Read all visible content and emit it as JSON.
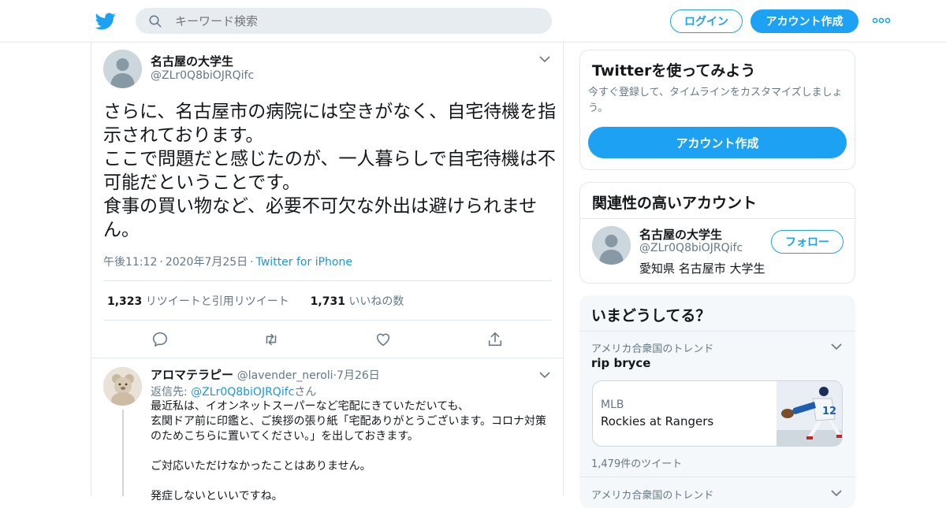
{
  "header": {
    "search_placeholder": "キーワード検索",
    "login_label": "ログイン",
    "signup_label": "アカウント作成"
  },
  "tweet": {
    "display_name": "名古屋の大学生",
    "handle": "@ZLr0Q8biOJRQifc",
    "lines": [
      "さらに、名古屋市の病院には空きがなく、自宅待機を指示されております。",
      "ここで問題だと感じたのが、一人暮らしで自宅待機は不可能だということです。",
      "食事の買い物など、必要不可欠な外出は避けられません。"
    ],
    "time": "午後11:12",
    "date": "2020年7月25日",
    "source": "Twitter for iPhone",
    "retweet_count": "1,323",
    "retweet_label": "リツイートと引用リツイート",
    "like_count": "1,731",
    "like_label": "いいねの数"
  },
  "reply": {
    "display_name": "アロマテラピー",
    "handle": "@lavender_neroli",
    "date": "7月26日",
    "reply_to_prefix": "返信先: ",
    "reply_to_handle": "@ZLr0Q8biOJRQifc",
    "reply_to_suffix": "さん",
    "paragraphs": [
      "最近私は、イオンネットスーパーなど宅配にきていただいても、\n玄関ドア前に印鑑と、ご挨拶の張り紙「宅配ありがとうございます。コロナ対策のためこちらに置いてください。」を出しておきます。",
      "ご対応いただけなかったことはありません。",
      "発症しないといいですね。"
    ]
  },
  "sidebar": {
    "signup_card": {
      "title": "Twitterを使ってみよう",
      "subtitle": "今すぐ登録して、タイムラインをカスタマイズしましょう。",
      "button": "アカウント作成"
    },
    "related": {
      "title": "関連性の高いアカウント",
      "name": "名古屋の大学生",
      "handle": "@ZLr0Q8biOJRQifc",
      "bio": "愛知県 名古屋市 大学生",
      "follow_label": "フォロー"
    },
    "trends": {
      "title": "いまどうしてる？",
      "items": [
        {
          "context": "アメリカ合衆国のトレンド",
          "name": "rip bryce"
        },
        {
          "context": "アメリカ合衆国のトレンド",
          "name": ""
        }
      ],
      "news": {
        "category": "MLB",
        "headline": "Rockies at Rangers"
      },
      "tweet_count": "1,479件のツイート"
    }
  },
  "colors": {
    "accent": "#1da1f2",
    "link": "#1b95e0",
    "muted": "#657786",
    "border": "#e1e8ed"
  }
}
